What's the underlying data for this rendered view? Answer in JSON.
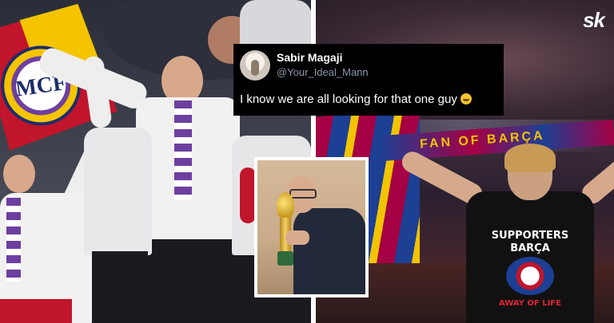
{
  "watermark": {
    "logo_text": "sk"
  },
  "tweet": {
    "display_name": "Sabir Magaji",
    "handle": "@Your_Ideal_Mann",
    "text": "I know we are all looking for that one guy",
    "emoji": "laughing-tears-emoji"
  },
  "left_photo": {
    "scene": "real-madrid-fans",
    "flag_colors": [
      "#c0152b",
      "#f4c400"
    ],
    "scarf_color": "#6d3fa0"
  },
  "right_photo": {
    "scene": "barcelona-fans",
    "banner_text": "FAN OF BARÇA",
    "tshirt_lines": [
      "SUPPORTERS",
      "BARÇA"
    ],
    "tshirt_bottom": "AWAY OF LIFE",
    "club_colors": [
      "#a50044",
      "#1d3f94",
      "#f2c400"
    ]
  },
  "inset_photo": {
    "subject": "man-holding-world-cup-trophy"
  }
}
